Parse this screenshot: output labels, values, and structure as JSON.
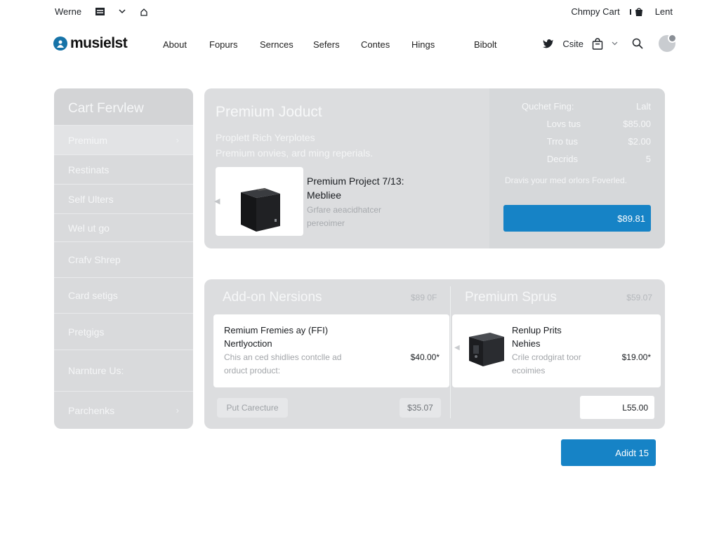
{
  "utility": {
    "left_label": "Werne",
    "right_cart": "Chmpy Cart",
    "right_label": "Lent",
    "icons": [
      "menu-icon",
      "chevron-down-icon",
      "home-icon",
      "cart-icon"
    ]
  },
  "nav": {
    "brand": "musielst",
    "links": [
      "About",
      "Fopurs",
      "Sernces",
      "Sefers",
      "Contes",
      "Hings",
      "Bibolt"
    ],
    "social_label": "Csite"
  },
  "sidebar": {
    "title": "Cart Fervlew",
    "items": [
      {
        "label": "Premium"
      },
      {
        "label": "Restinats"
      },
      {
        "label": "Self Ulters"
      },
      {
        "label": "Wel ut go"
      },
      {
        "label": "Crafv Shrep"
      },
      {
        "label": "Card setigs"
      },
      {
        "label": "Pretgigs"
      },
      {
        "label": "Narnture Us:"
      },
      {
        "label": "Parchenks"
      }
    ]
  },
  "product": {
    "title": "Premium Joduct",
    "subtitle_1": "Proplett Rich Yerplotes",
    "subtitle_2": "Premium onvies, ard ming reperials.",
    "name_1": "Premium Project 7/13:",
    "name_2": "Mebliee",
    "desc_1": "Grfare aeacidhatcer",
    "desc_2": "pereoimer"
  },
  "summary": {
    "header_label": "Quchet Fing:",
    "header_value": "Lalt",
    "rows": [
      {
        "label": "Lovs tus",
        "value": "$85.00"
      },
      {
        "label": "Trro tus",
        "value": "$2.00"
      },
      {
        "label": "Decrids",
        "value": "5"
      }
    ],
    "note": "Dravis your med orlors Foverled.",
    "checkout_label": "$89.81"
  },
  "addons": {
    "left_title": "Add-on Nersions",
    "left_price": "$89 0F",
    "right_title": "Premium Sprus",
    "right_price": "$59.07",
    "item_left": {
      "name_1": "Remium Fremies ay (FFI)",
      "name_2": "Nertlyoction",
      "desc_1": "Chis an ced shidlies contclle ad",
      "desc_2": "orduct product:",
      "price": "$40.00*"
    },
    "item_right": {
      "name_1": "Renlup Prits",
      "name_2": "Nehies",
      "desc_1": "Crile crodgirat toor",
      "desc_2": "ecoimies",
      "price": "$19.00*"
    },
    "footer_left": "Put Carecture",
    "footer_price": "$35.07",
    "promo_value": "L55.00"
  },
  "add_button": "Adidt 15",
  "colors": {
    "accent": "#1683c6",
    "panel": "#dcdddf",
    "brand": "#1673a8"
  }
}
